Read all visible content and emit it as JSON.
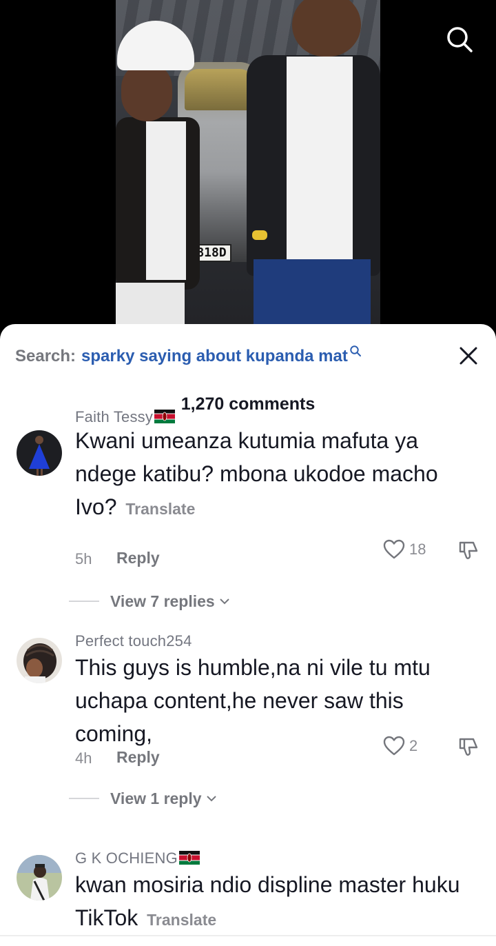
{
  "video": {
    "plate_text": "818D"
  },
  "search": {
    "prefix": "Search:",
    "query": "sparky saying about kupanda mat"
  },
  "comments_header": {
    "count_label": "1,270 comments"
  },
  "comments": [
    {
      "username": "Faith Tessy",
      "flag": "kenya-flag-icon",
      "text": "Kwani umeanza kutumia mafuta ya ndege katibu? mbona ukodoe macho Ivo?",
      "translate": "Translate",
      "time": "5h",
      "reply": "Reply",
      "likes": "18",
      "view_replies": "View 7 replies"
    },
    {
      "username": "Perfect touch254",
      "text": "This guys is humble,na ni vile tu mtu uchapa content,he never saw this coming,",
      "time": "4h",
      "reply": "Reply",
      "likes": "2",
      "view_replies": "View 1 reply"
    },
    {
      "username": "G K OCHIENG",
      "flag": "kenya-flag-icon",
      "text": "kwan mosiria ndio displine master huku TikTok",
      "translate": "Translate"
    }
  ],
  "icons": {
    "search": "search-icon",
    "close": "close-icon",
    "like": "heart-icon",
    "dislike": "dislike-icon",
    "chevron": "chevron-down-icon",
    "flag": "kenya-flag-icon"
  },
  "colors": {
    "link_blue": "#2b5db0",
    "text_primary": "#161823",
    "text_secondary": "#8a8b91"
  }
}
